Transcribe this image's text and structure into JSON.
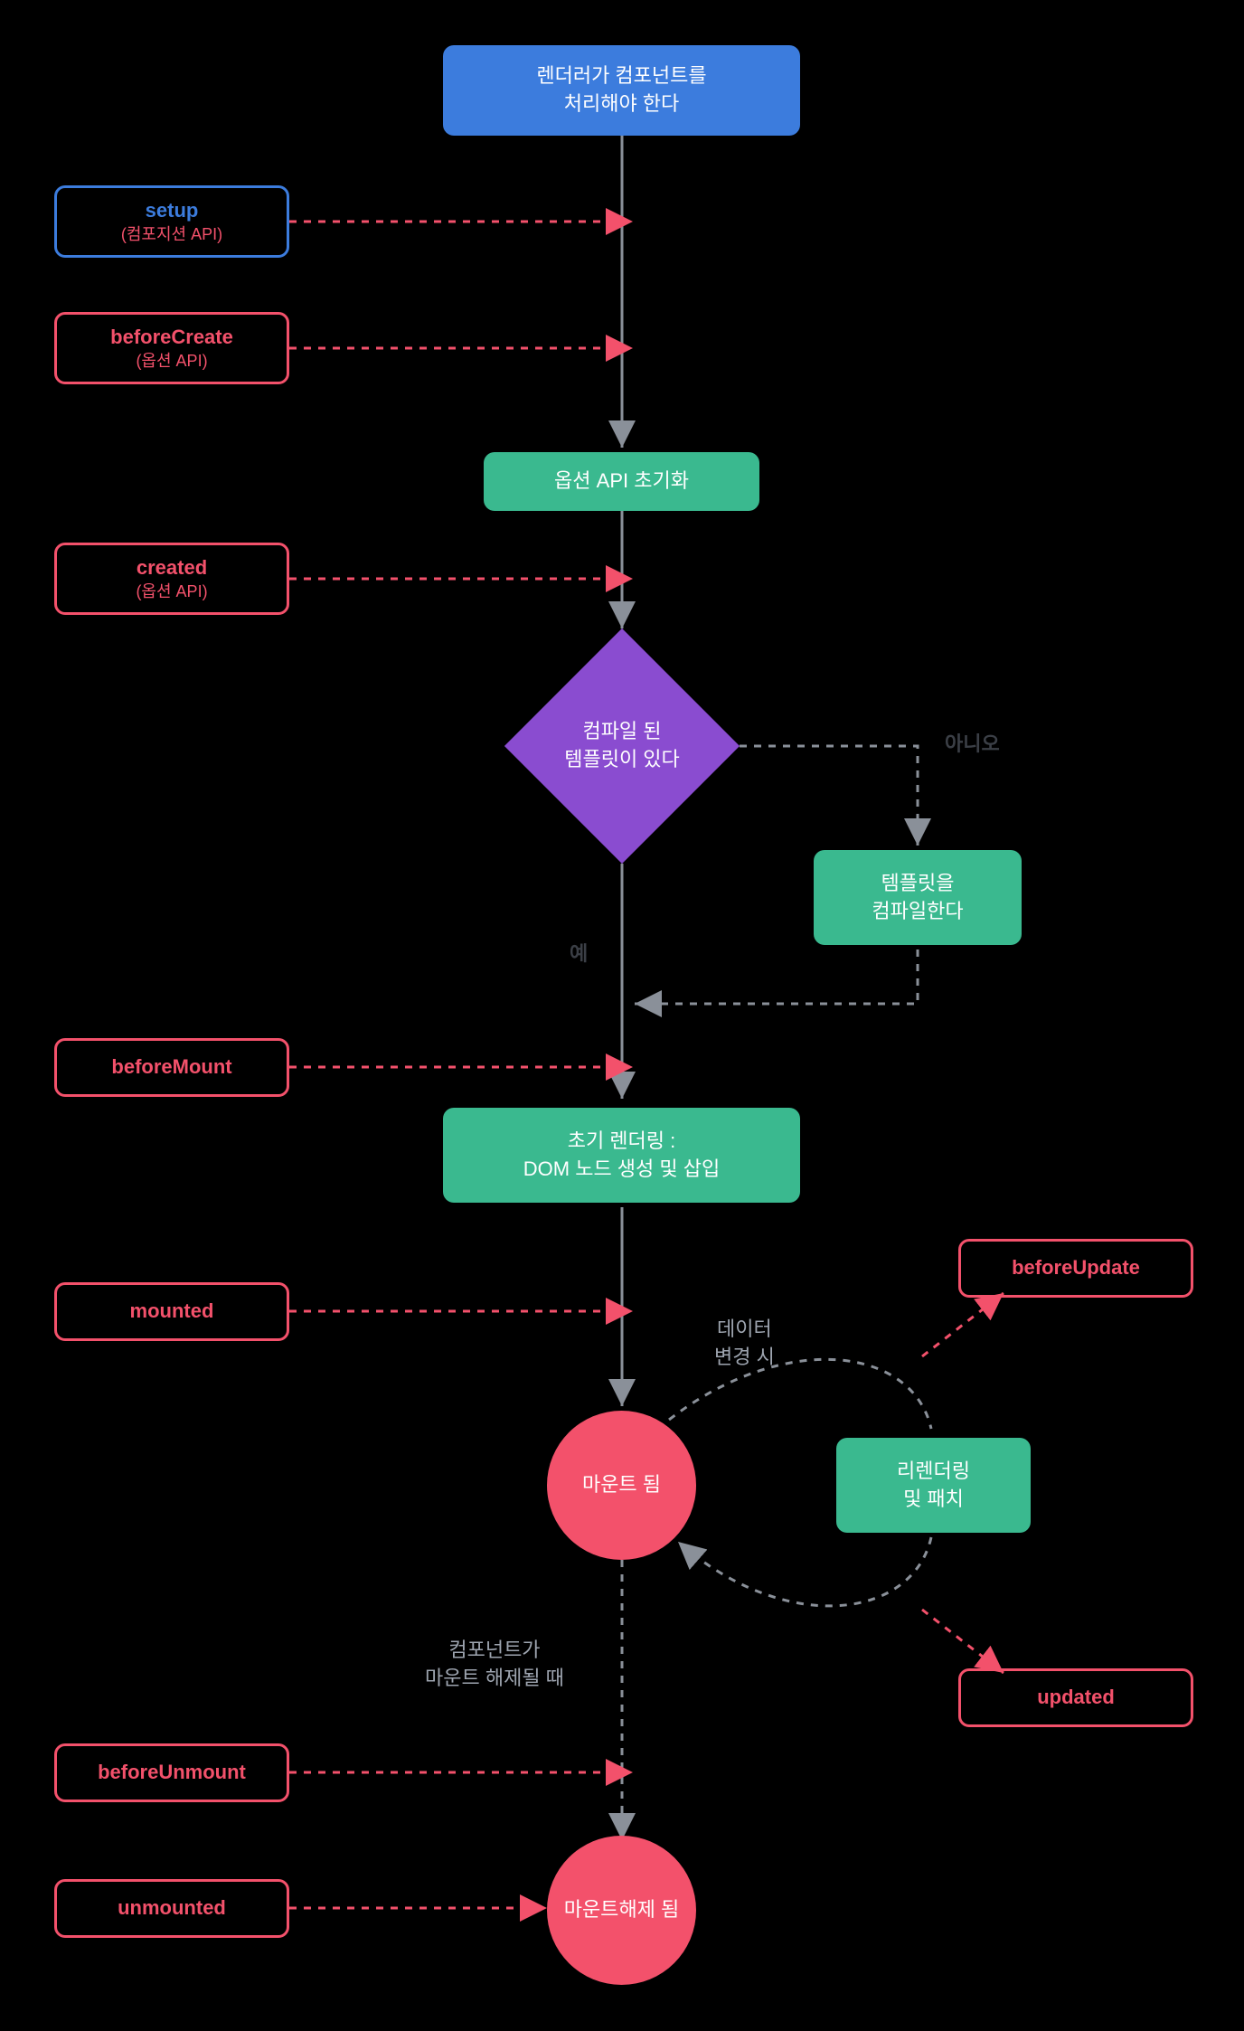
{
  "chart_data": {
    "type": "flowchart",
    "title": "Vue Component Lifecycle",
    "nodes": [
      {
        "id": "start",
        "type": "process",
        "color": "blue",
        "label": "렌더러가 컴포넌트를\n처리해야 한다"
      },
      {
        "id": "init",
        "type": "process",
        "color": "green",
        "label": "옵션 API 초기화"
      },
      {
        "id": "compiled",
        "type": "decision",
        "color": "purple",
        "label": "컴파일 된\n템플릿이 있다"
      },
      {
        "id": "compile",
        "type": "process",
        "color": "green",
        "label": "템플릿을\n컴파일한다"
      },
      {
        "id": "render",
        "type": "process",
        "color": "green",
        "label": "초기 렌더링 :\nDOM 노드 생성 및 삽입"
      },
      {
        "id": "mounted",
        "type": "terminal",
        "color": "red",
        "label": "마운트 됨"
      },
      {
        "id": "rerender",
        "type": "process",
        "color": "green",
        "label": "리렌더링\n및 패치"
      },
      {
        "id": "unmounted",
        "type": "terminal",
        "color": "red",
        "label": "마운트\n해제 됨"
      }
    ],
    "hooks": [
      {
        "id": "setup",
        "title": "setup",
        "sub": "(컴포지션 API)",
        "border": "blue"
      },
      {
        "id": "beforeCreate",
        "title": "beforeCreate",
        "sub": "(옵션 API)",
        "border": "red"
      },
      {
        "id": "created",
        "title": "created",
        "sub": "(옵션 API)",
        "border": "red"
      },
      {
        "id": "beforeMount",
        "title": "beforeMount",
        "sub": "",
        "border": "red"
      },
      {
        "id": "mountedHook",
        "title": "mounted",
        "sub": "",
        "border": "red"
      },
      {
        "id": "beforeUpdate",
        "title": "beforeUpdate",
        "sub": "",
        "border": "red"
      },
      {
        "id": "updated",
        "title": "updated",
        "sub": "",
        "border": "red"
      },
      {
        "id": "beforeUnmount",
        "title": "beforeUnmount",
        "sub": "",
        "border": "red"
      },
      {
        "id": "unmountedHook",
        "title": "unmounted",
        "sub": "",
        "border": "red"
      }
    ],
    "edges": [
      {
        "from": "start",
        "to": "init",
        "style": "solid"
      },
      {
        "from": "init",
        "to": "compiled",
        "style": "solid"
      },
      {
        "from": "compiled",
        "to": "render",
        "label": "예",
        "style": "solid"
      },
      {
        "from": "compiled",
        "to": "compile",
        "label": "아니오",
        "style": "dashed"
      },
      {
        "from": "compile",
        "to": "render",
        "style": "dashed"
      },
      {
        "from": "render",
        "to": "mounted",
        "style": "solid"
      },
      {
        "from": "mounted",
        "to": "rerender",
        "label": "데이터\n변경 시",
        "style": "dashed-loop"
      },
      {
        "from": "mounted",
        "to": "unmounted",
        "label": "컴포넌트가\n마운트 해제될 때",
        "style": "dashed"
      }
    ],
    "edge_labels": {
      "yes": "예",
      "no": "아니오",
      "data_change": "데이터\n변경 시",
      "unmount_when": "컴포넌트가\n마운트 해제될 때"
    }
  },
  "nodes": {
    "start": {
      "line1": "렌더러가 컴포넌트를",
      "line2": "처리해야 한다"
    },
    "init": "옵션 API 초기화",
    "compiled": {
      "line1": "컴파일 된",
      "line2": "템플릿이 있다"
    },
    "compile": {
      "line1": "템플릿을",
      "line2": "컴파일한다"
    },
    "render": {
      "line1": "초기 렌더링 :",
      "line2": "DOM 노드 생성 및 삽입"
    },
    "mounted": "마운트 됨",
    "rerender": {
      "line1": "리렌더링",
      "line2": "및 패치"
    },
    "unmounted": {
      "line1": "마운트",
      "line2": "해제 됨"
    }
  },
  "hooks": {
    "setup": {
      "title": "setup",
      "sub": "(컴포지션 API)"
    },
    "beforeCreate": {
      "title": "beforeCreate",
      "sub": "(옵션 API)"
    },
    "created": {
      "title": "created",
      "sub": "(옵션 API)"
    },
    "beforeMount": "beforeMount",
    "mountedHook": "mounted",
    "beforeUpdate": "beforeUpdate",
    "updated": "updated",
    "beforeUnmount": "beforeUnmount",
    "unmountedHook": "unmounted"
  },
  "labels": {
    "yes": "예",
    "no": "아니오",
    "data_change_1": "데이터",
    "data_change_2": "변경 시",
    "unmount_1": "컴포넌트가",
    "unmount_2": "마운트 해제될 때"
  }
}
